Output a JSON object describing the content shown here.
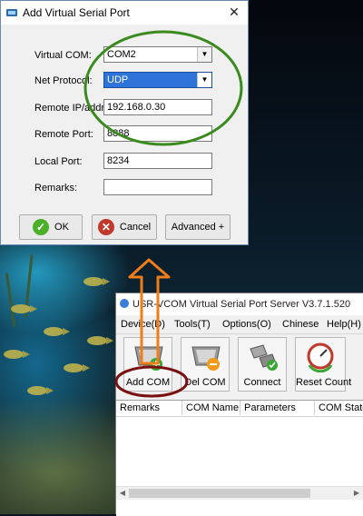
{
  "dialog": {
    "title": "Add Virtual Serial Port",
    "close_glyph": "✕",
    "fields": {
      "virtual_com_label": "Virtual COM:",
      "virtual_com_value": "COM2",
      "net_protocol_label": "Net Protocol:",
      "net_protocol_value": "UDP",
      "remote_ip_label": "Remote IP/addr:",
      "remote_ip_value": "192.168.0.30",
      "remote_port_label": "Remote Port:",
      "remote_port_value": "8888",
      "local_port_label": "Local Port:",
      "local_port_value": "8234",
      "remarks_label": "Remarks:",
      "remarks_value": ""
    },
    "buttons": {
      "ok": "OK",
      "cancel": "Cancel",
      "advanced": "Advanced +"
    }
  },
  "app": {
    "title": "USR-VCOM Virtual Serial Port Server V3.7.1.520",
    "menu": [
      "Device(D)",
      "Tools(T)",
      "Options(O)",
      "Chinese",
      "Help(H)"
    ],
    "toolbar": [
      "Add COM",
      "Del COM",
      "Connect",
      "Reset Count"
    ],
    "table_columns": [
      "Remarks",
      "COM Name",
      "Parameters",
      "COM State"
    ]
  },
  "colors": {
    "annotation_green": "#3a8a1e",
    "annotation_orange": "#ef7d1a",
    "annotation_darkred": "#7a1010",
    "selection_blue": "#2e74d8"
  },
  "icons": {
    "ok": "check-circle-icon",
    "cancel": "x-circle-icon",
    "add_com": "serial-connector-add-icon",
    "del_com": "serial-connector-remove-icon",
    "connect": "connect-plug-icon",
    "reset_count": "gauge-reset-icon"
  }
}
